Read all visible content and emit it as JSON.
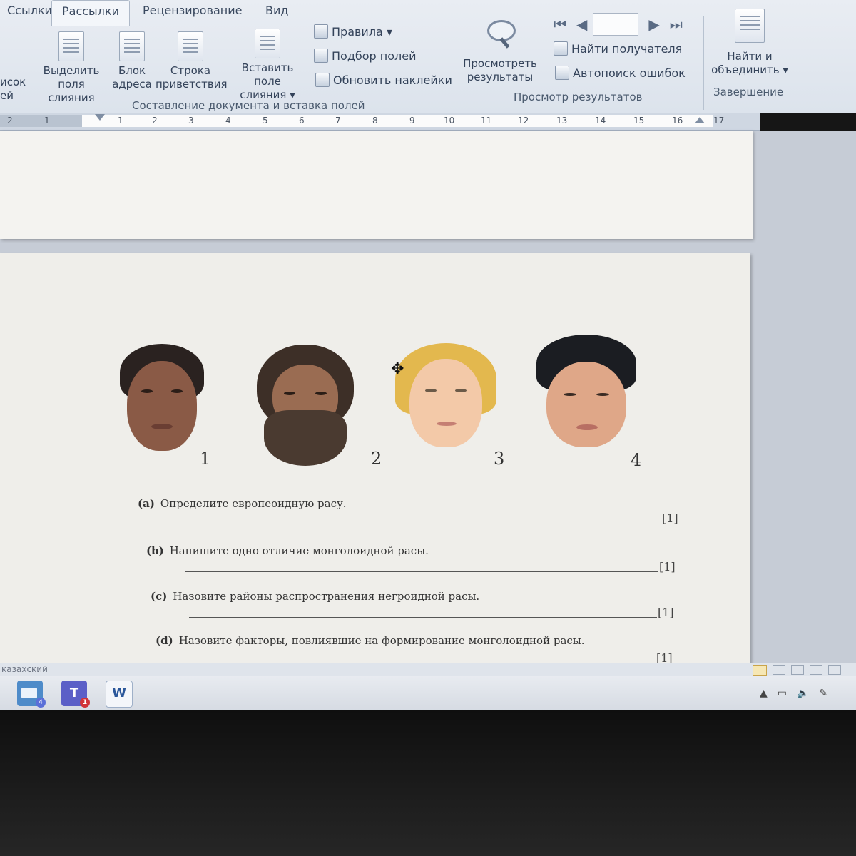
{
  "ribbon": {
    "tabs": [
      {
        "label": "Ссылки",
        "active": false
      },
      {
        "label": "Рассылки",
        "active": true
      },
      {
        "label": "Рецензирование",
        "active": false
      },
      {
        "label": "Вид",
        "active": false
      }
    ],
    "partial_left_1": "исок",
    "partial_left_2": "ей",
    "big_buttons": [
      {
        "line1": "Выделить",
        "line2": "поля слияния"
      },
      {
        "line1": "Блок",
        "line2": "адреса"
      },
      {
        "line1": "Строка",
        "line2": "приветствия"
      },
      {
        "line1": "Вставить поле",
        "line2": "слияния ▾"
      }
    ],
    "small_buttons": [
      "Правила ▾",
      "Подбор полей",
      "Обновить наклейки"
    ],
    "group_compose": "Составление документа и вставка полей",
    "preview_button": {
      "line1": "Просмотреть",
      "line2": "результаты"
    },
    "find_recipient": "Найти получателя",
    "auto_check": "Автопоиск ошибок",
    "group_preview": "Просмотр результатов",
    "finish_button": {
      "line1": "Найти и",
      "line2": "объединить ▾"
    },
    "group_finish": "Завершение",
    "nav": {
      "first": "⏮",
      "prev": "◀",
      "next": "▶",
      "last": "⏭"
    }
  },
  "ruler": {
    "labels": [
      "2",
      "1",
      "1",
      "2",
      "3",
      "4",
      "5",
      "6",
      "7",
      "8",
      "9",
      "10",
      "11",
      "12",
      "13",
      "14",
      "15",
      "16",
      "17"
    ]
  },
  "document": {
    "face_numbers": [
      "1",
      "2",
      "3",
      "4"
    ],
    "questions": [
      {
        "label": "(a)",
        "text": "Определите европеоидную расу.",
        "mark": "[1]"
      },
      {
        "label": "(b)",
        "text": "Напишите  одно отличие монголоидной расы.",
        "mark": "[1]"
      },
      {
        "label": "(c)",
        "text": "Назовите районы распространения негроидной расы.",
        "mark": "[1]"
      },
      {
        "label": "(d)",
        "text": "Назовите факторы, повлиявшие на формирование монголоидной расы.",
        "mark": "[1]"
      }
    ]
  },
  "statusbar": {
    "language": "казахский"
  },
  "taskbar": {
    "apps": [
      {
        "name": "mail",
        "badge": "4"
      },
      {
        "name": "teams",
        "label": "T",
        "badge": "1"
      },
      {
        "name": "word",
        "label": "W"
      }
    ]
  },
  "colors": {
    "accent": "#2b579a",
    "ribbon_bg": "#e3e8ef",
    "page": "#efeeea"
  }
}
